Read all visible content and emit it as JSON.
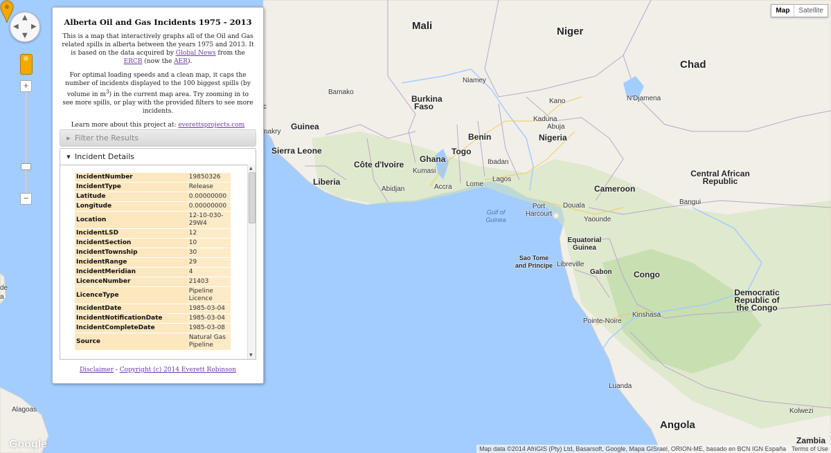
{
  "panel": {
    "title": "Alberta Oil and Gas Incidents 1975 - 2013",
    "intro1_a": "This is a map that interactively graphs all of the Oil and Gas related spills in alberta between the years 1975 and 2013. It is based on the data acquired by ",
    "intro1_link_global": "Global News",
    "intro1_b": " from the ",
    "intro1_link_ercb": "ERCB",
    "intro1_c": " (now the ",
    "intro1_link_aer": "AER",
    "intro1_d": ").",
    "intro2_a": "For optimal loading speeds and a clean map, it caps the number of incidents displayed to the 100 biggest spills (by volume in m",
    "intro2_sup": "3",
    "intro2_b": ") in the current map area. Try zooming in to see more spills, or play with the provided filters to see more incidents.",
    "intro3": "Learn more about this project at: ",
    "intro3_link": "everettsprojects.com",
    "filter_header": "Filter the Results",
    "details_header": "Incident Details",
    "footer_disclaimer": "Disclaimer",
    "footer_sep": " - ",
    "footer_copyright": "Copyright (c) 2014 Everett Robinson",
    "details": [
      {
        "key": "IncidentNumber",
        "value": "19850326"
      },
      {
        "key": "IncidentType",
        "value": "Release"
      },
      {
        "key": "Latitude",
        "value": "0.00000000"
      },
      {
        "key": "Longitude",
        "value": "0.00000000"
      },
      {
        "key": "Location",
        "value": "12-10-030-29W4"
      },
      {
        "key": "IncidentLSD",
        "value": "12"
      },
      {
        "key": "IncidentSection",
        "value": "10"
      },
      {
        "key": "IncidentTownship",
        "value": "30"
      },
      {
        "key": "IncidentRange",
        "value": "29"
      },
      {
        "key": "IncidentMeridian",
        "value": "4"
      },
      {
        "key": "LicenceNumber",
        "value": "21403"
      },
      {
        "key": "LicenceType",
        "value": "Pipeline Licence"
      },
      {
        "key": "IncidentDate",
        "value": "1985-03-04"
      },
      {
        "key": "IncidentNotificationDate",
        "value": "1985-03-04"
      },
      {
        "key": "IncidentCompleteDate",
        "value": "1985-03-08"
      },
      {
        "key": "Source",
        "value": "Natural Gas Pipeline"
      }
    ]
  },
  "map": {
    "type_buttons": [
      "Map",
      "Satellite"
    ],
    "active_type": "Map",
    "zoom_in": "+",
    "zoom_out": "−",
    "attribution": "Map data ©2014 AfriGIS (Pty) Ltd, Basarsoft, Google, Mapa GISrael, ORION-ME, basado en BCN IGN España",
    "terms": "Terms of Use",
    "logo": "Google",
    "marker_icon": "map-pin-icon",
    "marker_color": "#f2a900",
    "ocean_color": "#a3ccff",
    "land_color": "#f2efe9",
    "places": {
      "mali": "Mali",
      "niger": "Niger",
      "chad": "Chad",
      "nigeria": "Nigeria",
      "burkina": "Burkina Faso",
      "guinea": "Guinea",
      "sierra_leone": "Sierra Leone",
      "liberia": "Liberia",
      "cote": "Côte d'Ivoire",
      "ghana": "Ghana",
      "togo": "Togo",
      "benin": "Benin",
      "car": "Central African Republic",
      "cameroon": "Cameroon",
      "eq_guinea": "Equatorial Guinea",
      "sao_tome": "Sao Tome and Principe",
      "gabon": "Gabon",
      "congo": "Congo",
      "drc": "Democratic Republic of the Congo",
      "angola": "Angola",
      "zambia": "Zambia",
      "gulf": "Gulf of Guinea",
      "bamako": "Bamako",
      "niamey": "Niamey",
      "ndjamena": "N'Djamena",
      "kano": "Kano",
      "kaduna": "Kaduna",
      "abuja": "Abuja",
      "ibadan": "Ibadan",
      "lagos": "Lagos",
      "lome": "Lome",
      "accra": "Accra",
      "kumasi": "Kumasi",
      "abidjan": "Abidjan",
      "port_harcourt": "Port Harcourt",
      "douala": "Douala",
      "yaounde": "Yaounde",
      "bangui": "Bangui",
      "libreville": "Libreville",
      "pointe_noire": "Pointe-Noire",
      "kinshasa": "Kinshasa",
      "luanda": "Luanda",
      "kolwezi": "Kolwezi",
      "conakry": "nakry",
      "alagoas": "Alagoas",
      "edge_de": "de",
      "edge_a": "a",
      "edge_partial": "c"
    }
  }
}
